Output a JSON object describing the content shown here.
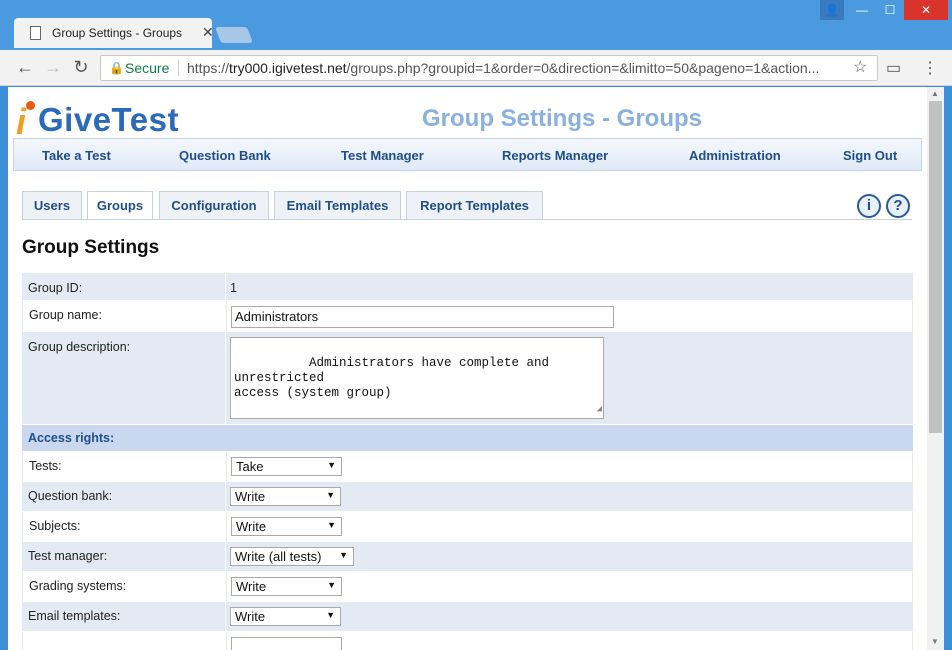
{
  "browser": {
    "tab_title": "Group Settings - Groups",
    "secure_label": "Secure",
    "url_scheme": "https://",
    "url_host": "try000.igivetest.net",
    "url_rest": "/groups.php?groupid=1&order=0&direction=&limitto=50&pageno=1&action..."
  },
  "logo": {
    "i": "i",
    "text": "GiveTest"
  },
  "page_title": "Group Settings - Groups",
  "main_nav": [
    "Take a Test",
    "Question Bank",
    "Test Manager",
    "Reports Manager",
    "Administration",
    "Sign Out"
  ],
  "sub_tabs": [
    "Users",
    "Groups",
    "Configuration",
    "Email Templates",
    "Report Templates"
  ],
  "help": {
    "info": "i",
    "question": "?"
  },
  "section_title": "Group Settings",
  "form": {
    "group_id_label": "Group ID:",
    "group_id_value": "1",
    "group_name_label": "Group name:",
    "group_name_value": "Administrators",
    "group_desc_label": "Group description:",
    "group_desc_value": "Administrators have complete and unrestricted\naccess (system group)",
    "access_rights_label": "Access rights:",
    "rights": [
      {
        "label": "Tests:",
        "value": "Take"
      },
      {
        "label": "Question bank:",
        "value": "Write"
      },
      {
        "label": "Subjects:",
        "value": "Write"
      },
      {
        "label": "Test manager:",
        "value": "Write (all tests)"
      },
      {
        "label": "Grading systems:",
        "value": "Write"
      },
      {
        "label": "Email templates:",
        "value": "Write"
      }
    ]
  }
}
